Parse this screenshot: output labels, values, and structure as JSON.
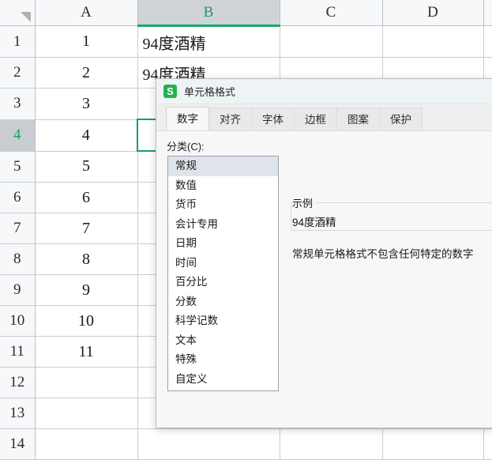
{
  "spreadsheet": {
    "corner_icon": "select-all-triangle-icon",
    "columns": [
      {
        "label": "A",
        "selected": false
      },
      {
        "label": "B",
        "selected": true
      },
      {
        "label": "C",
        "selected": false
      },
      {
        "label": "D",
        "selected": false
      }
    ],
    "rows": [
      {
        "header": "1",
        "selected": false,
        "a": "1",
        "b": "94度酒精",
        "c": "",
        "d": ""
      },
      {
        "header": "2",
        "selected": false,
        "a": "2",
        "b": "94度酒精",
        "c": "",
        "d": ""
      },
      {
        "header": "3",
        "selected": false,
        "a": "3",
        "b": "",
        "c": "",
        "d": ""
      },
      {
        "header": "4",
        "selected": true,
        "a": "4",
        "b": "",
        "c": "",
        "d": ""
      },
      {
        "header": "5",
        "selected": false,
        "a": "5",
        "b": "",
        "c": "",
        "d": ""
      },
      {
        "header": "6",
        "selected": false,
        "a": "6",
        "b": "",
        "c": "",
        "d": ""
      },
      {
        "header": "7",
        "selected": false,
        "a": "7",
        "b": "",
        "c": "",
        "d": ""
      },
      {
        "header": "8",
        "selected": false,
        "a": "8",
        "b": "",
        "c": "",
        "d": ""
      },
      {
        "header": "9",
        "selected": false,
        "a": "9",
        "b": "",
        "c": "",
        "d": ""
      },
      {
        "header": "10",
        "selected": false,
        "a": "10",
        "b": "",
        "c": "",
        "d": ""
      },
      {
        "header": "11",
        "selected": false,
        "a": "11",
        "b": "",
        "c": "",
        "d": ""
      },
      {
        "header": "12",
        "selected": false,
        "a": "",
        "b": "",
        "c": "",
        "d": ""
      },
      {
        "header": "13",
        "selected": false,
        "a": "",
        "b": "",
        "c": "",
        "d": ""
      },
      {
        "header": "14",
        "selected": false,
        "a": "",
        "b": "",
        "c": "",
        "d": ""
      }
    ],
    "active_cell": "B4",
    "accent_color": "#15a05c",
    "header_selected_bg": "#c9cdd2"
  },
  "dialog": {
    "icon": "wps-spreadsheet-icon",
    "icon_letter": "S",
    "icon_color": "#25b14e",
    "title": "单元格格式",
    "tabs": [
      {
        "label": "数字",
        "active": true
      },
      {
        "label": "对齐",
        "active": false
      },
      {
        "label": "字体",
        "active": false
      },
      {
        "label": "边框",
        "active": false
      },
      {
        "label": "图案",
        "active": false
      },
      {
        "label": "保护",
        "active": false
      }
    ],
    "category": {
      "label": "分类(C):",
      "selected": "常规",
      "items": [
        "常规",
        "数值",
        "货币",
        "会计专用",
        "日期",
        "时间",
        "百分比",
        "分数",
        "科学记数",
        "文本",
        "特殊",
        "自定义"
      ]
    },
    "sample": {
      "legend": "示例",
      "value": "94度酒精"
    },
    "description": "常规单元格格式不包含任何特定的数字"
  }
}
